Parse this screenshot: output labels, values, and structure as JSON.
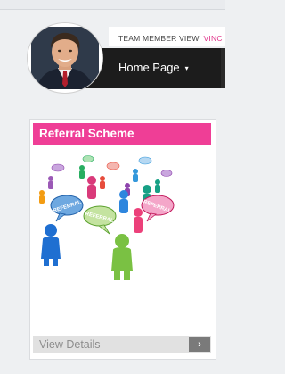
{
  "header": {
    "member_label": "TEAM MEMBER VIEW: ",
    "member_name": "VINC"
  },
  "nav": {
    "home_label": "Home Page",
    "caret": "▾"
  },
  "card": {
    "title": "Referral Scheme",
    "bubble_texts": [
      "REFERRAL",
      "REFERRAL",
      "REFERRAL"
    ],
    "view_details": "View Details",
    "arrow": "›"
  },
  "colors": {
    "accent_pink": "#ef3e96",
    "nav_bg": "#1c1c1c"
  }
}
